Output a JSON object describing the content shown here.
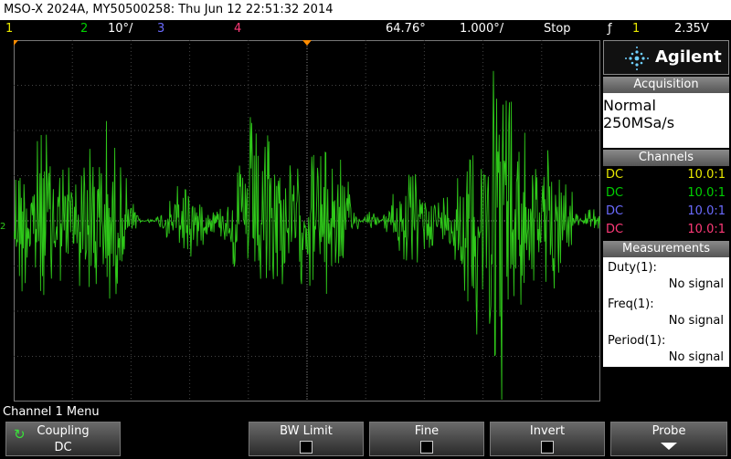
{
  "title_bar": "MSO-X 2024A, MY50500258: Thu Jun 12 22:51:32 2014",
  "status_bar": {
    "ch1": "1",
    "ch2": "2",
    "ch2_scale": "10°/",
    "ch3": "3",
    "ch4": "4",
    "delay": "64.76°",
    "timebase": "1.000°/",
    "run_state": "Stop",
    "trigger_icon": "ƒ",
    "trigger_channel": "1",
    "trigger_level": "2.35V"
  },
  "colors": {
    "ch1": "#e8e800",
    "ch2": "#00d000",
    "ch3": "#6b6bff",
    "ch4": "#ff3a78",
    "trace": "#2fc81a"
  },
  "waveform": {
    "channel": "2",
    "marker": "2"
  },
  "right_panel": {
    "brand": "Agilent",
    "acquisition": {
      "header": "Acquisition",
      "mode": "Normal",
      "rate": "250MSa/s"
    },
    "channels": {
      "header": "Channels",
      "rows": [
        {
          "coupling": "DC",
          "probe": "10.0:1"
        },
        {
          "coupling": "DC",
          "probe": "10.0:1"
        },
        {
          "coupling": "DC",
          "probe": "10.0:1"
        },
        {
          "coupling": "DC",
          "probe": "10.0:1"
        }
      ]
    },
    "measurements": {
      "header": "Measurements",
      "items": [
        {
          "label": "Duty(1):",
          "value": "No signal"
        },
        {
          "label": "Freq(1):",
          "value": "No signal"
        },
        {
          "label": "Period(1):",
          "value": "No signal"
        }
      ]
    }
  },
  "menu": {
    "title": "Channel 1 Menu",
    "softkeys": [
      {
        "label": "Coupling",
        "value": "DC"
      },
      {
        "label": "BW Limit"
      },
      {
        "label": "Fine"
      },
      {
        "label": "Invert"
      },
      {
        "label": "Probe"
      }
    ]
  }
}
